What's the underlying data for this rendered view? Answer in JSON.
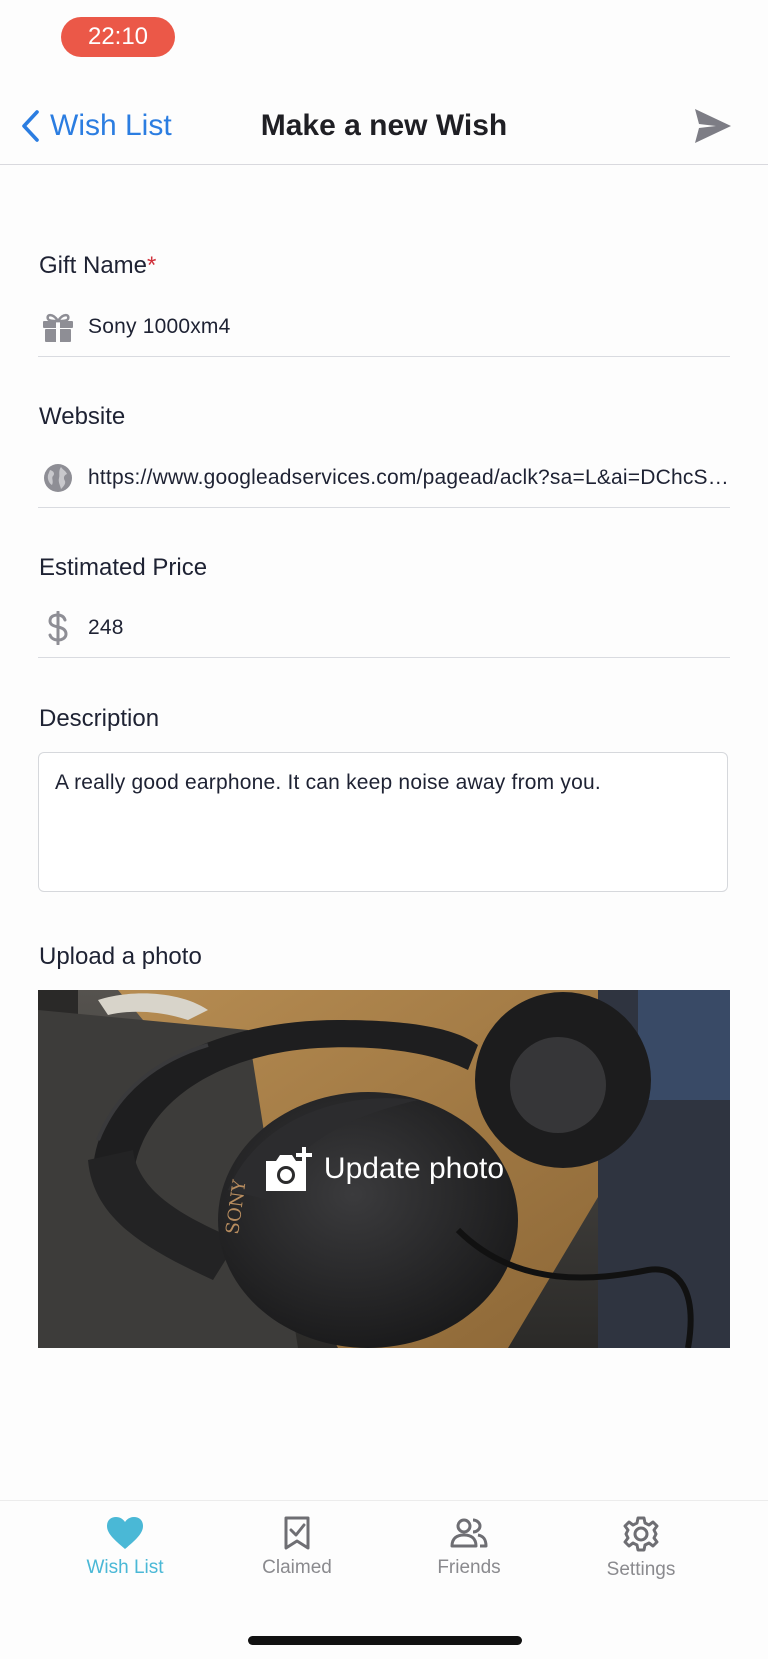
{
  "status_bar": {
    "time": "22:10"
  },
  "nav": {
    "back_label": "Wish List",
    "title": "Make a new Wish"
  },
  "form": {
    "gift_name": {
      "label": "Gift Name",
      "required_mark": "*",
      "value": "Sony 1000xm4",
      "icon": "gift-icon"
    },
    "website": {
      "label": "Website",
      "value": "https://www.googleadservices.com/pagead/aclk?sa=L&ai=DChcSEwi",
      "icon": "globe-icon"
    },
    "price": {
      "label": "Estimated Price",
      "value": "248",
      "icon": "dollar-icon"
    },
    "description": {
      "label": "Description",
      "value": "A really good earphone. It can keep noise away from you."
    },
    "photo": {
      "label": "Upload a photo",
      "button_label": "Update photo",
      "icon": "camera-plus-icon"
    }
  },
  "tabs": [
    {
      "label": "Wish List",
      "icon": "heart-icon",
      "active": true
    },
    {
      "label": "Claimed",
      "icon": "bookmark-check-icon",
      "active": false
    },
    {
      "label": "Friends",
      "icon": "people-icon",
      "active": false
    },
    {
      "label": "Settings",
      "icon": "gear-icon",
      "active": false
    }
  ],
  "colors": {
    "accent": "#2b7de1",
    "tab_active": "#4ab8d6",
    "time_pill": "#eb5848",
    "required": "#d0303a"
  }
}
